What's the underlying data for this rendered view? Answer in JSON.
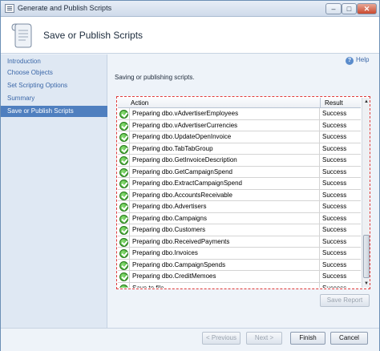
{
  "window": {
    "title": "Generate and Publish Scripts",
    "minimize": "–",
    "maximize": "□",
    "close": "✕"
  },
  "header": {
    "title": "Save or Publish Scripts",
    "icon": "scroll-icon"
  },
  "help": {
    "label": "Help",
    "icon": "help-icon"
  },
  "sidebar": {
    "items": [
      {
        "label": "Introduction"
      },
      {
        "label": "Choose Objects"
      },
      {
        "label": "Set Scripting Options"
      },
      {
        "label": "Summary"
      },
      {
        "label": "Save or Publish Scripts",
        "active": true
      }
    ]
  },
  "main": {
    "status": "Saving or publishing scripts."
  },
  "grid": {
    "columns": {
      "action": "Action",
      "result": "Result"
    },
    "rows": [
      {
        "action": "Preparing dbo.vAdvertiserEmployees",
        "result": "Success"
      },
      {
        "action": "Preparing dbo.vAdvertiserCurrencies",
        "result": "Success"
      },
      {
        "action": "Preparing dbo.UpdateOpenInvoice",
        "result": "Success"
      },
      {
        "action": "Preparing dbo.TabTabGroup",
        "result": "Success"
      },
      {
        "action": "Preparing dbo.GetInvoiceDescription",
        "result": "Success"
      },
      {
        "action": "Preparing dbo.GetCampaignSpend",
        "result": "Success"
      },
      {
        "action": "Preparing dbo.ExtractCampaignSpend",
        "result": "Success"
      },
      {
        "action": "Preparing dbo.AccountsReceivable",
        "result": "Success"
      },
      {
        "action": "Preparing dbo.Advertisers",
        "result": "Success"
      },
      {
        "action": "Preparing dbo.Campaigns",
        "result": "Success"
      },
      {
        "action": "Preparing dbo.Customers",
        "result": "Success"
      },
      {
        "action": "Preparing dbo.ReceivedPayments",
        "result": "Success"
      },
      {
        "action": "Preparing dbo.Invoices",
        "result": "Success"
      },
      {
        "action": "Preparing dbo.CampaignSpends",
        "result": "Success"
      },
      {
        "action": "Preparing dbo.CreditMemoes",
        "result": "Success"
      },
      {
        "action": "Save to file",
        "result": "Success"
      }
    ]
  },
  "buttons": {
    "save_report": "Save Report",
    "previous": "< Previous",
    "next": "Next >",
    "finish": "Finish",
    "cancel": "Cancel"
  },
  "colors": {
    "accent": "#4f7fbf",
    "success": "#2e9a1f",
    "focus_border": "#e03a3a"
  }
}
